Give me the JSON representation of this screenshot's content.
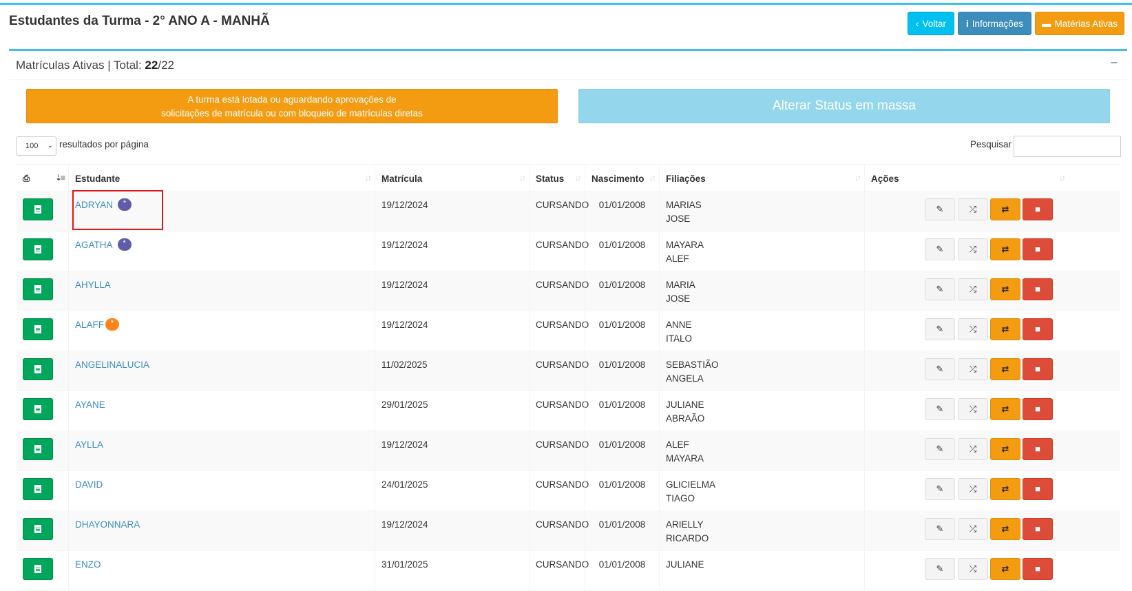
{
  "header": {
    "title": "Estudantes da Turma - 2° ANO A - MANHÃ",
    "buttons": {
      "back": "Voltar",
      "info": "Informações",
      "subjects": "Matérias Ativas"
    }
  },
  "box": {
    "title_prefix": "Matrículas Ativas | Total: ",
    "total_active": "22",
    "total_sep": "/",
    "total_all": "22",
    "collapse": "−"
  },
  "alert": {
    "line1": "A turma está lotada ou aguardando aprovações de",
    "line2": "solicitações de matrícula ou com bloqueio de matrículas diretas"
  },
  "mass_status_button": "Alterar Status em massa",
  "table_controls": {
    "page_length": "100",
    "page_length_label": "resultados por página",
    "search_label": "Pesquisar",
    "search_value": ""
  },
  "columns": [
    "Estudante",
    "Matrícula",
    "Status",
    "Nascimento",
    "Filiações",
    "Ações"
  ],
  "icons": {
    "print": "print-icon",
    "sort": "sort-icon",
    "document": "file-text-icon",
    "edit": "edit-icon",
    "shuffle": "shuffle-icon",
    "swap": "exchange-icon",
    "delete": "trash-icon"
  },
  "colors": {
    "accent_blue": "#3cc0ec",
    "info": "#00c0ef",
    "primary": "#3c8dbc",
    "warning": "#f39c12",
    "success": "#00a65a",
    "danger": "#dd4b39",
    "badge_purple": "#605ca8",
    "badge_orange": "#ff851b",
    "highlight": "#e0161b"
  },
  "rows": [
    {
      "name": "ADRYAN",
      "badge": "purple",
      "date": "19/12/2024",
      "status": "CURSANDO",
      "birth": "01/01/2008",
      "parent1": "MARIAS",
      "parent2": "JOSE"
    },
    {
      "name": "AGATHA",
      "badge": "purple",
      "date": "19/12/2024",
      "status": "CURSANDO",
      "birth": "01/01/2008",
      "parent1": "MAYARA",
      "parent2": "ALEF"
    },
    {
      "name": "AHYLLA",
      "badge": "",
      "date": "19/12/2024",
      "status": "CURSANDO",
      "birth": "01/01/2008",
      "parent1": "MARIA",
      "parent2": "JOSE"
    },
    {
      "name": "ALAFF",
      "badge": "orange",
      "date": "19/12/2024",
      "status": "CURSANDO",
      "birth": "01/01/2008",
      "parent1": "ANNE",
      "parent2": "ITALO"
    },
    {
      "name": "ANGELINALUCIA",
      "badge": "",
      "date": "11/02/2025",
      "status": "CURSANDO",
      "birth": "01/01/2008",
      "parent1": "SEBASTIÃO",
      "parent2": "ANGELA"
    },
    {
      "name": "AYANE",
      "badge": "",
      "date": "29/01/2025",
      "status": "CURSANDO",
      "birth": "01/01/2008",
      "parent1": "JULIANE",
      "parent2": "ABRAÃO"
    },
    {
      "name": "AYLLA",
      "badge": "",
      "date": "19/12/2024",
      "status": "CURSANDO",
      "birth": "01/01/2008",
      "parent1": "ALEF",
      "parent2": "MAYARA"
    },
    {
      "name": "DAVID",
      "badge": "",
      "date": "24/01/2025",
      "status": "CURSANDO",
      "birth": "01/01/2008",
      "parent1": "GLICIELMA",
      "parent2": "TIAGO"
    },
    {
      "name": "DHAYONNARA",
      "badge": "",
      "date": "19/12/2024",
      "status": "CURSANDO",
      "birth": "01/01/2008",
      "parent1": "ARIELLY",
      "parent2": "RICARDO"
    },
    {
      "name": "ENZO",
      "badge": "",
      "date": "31/01/2025",
      "status": "CURSANDO",
      "birth": "01/01/2008",
      "parent1": "JULIANE",
      "parent2": ""
    }
  ]
}
